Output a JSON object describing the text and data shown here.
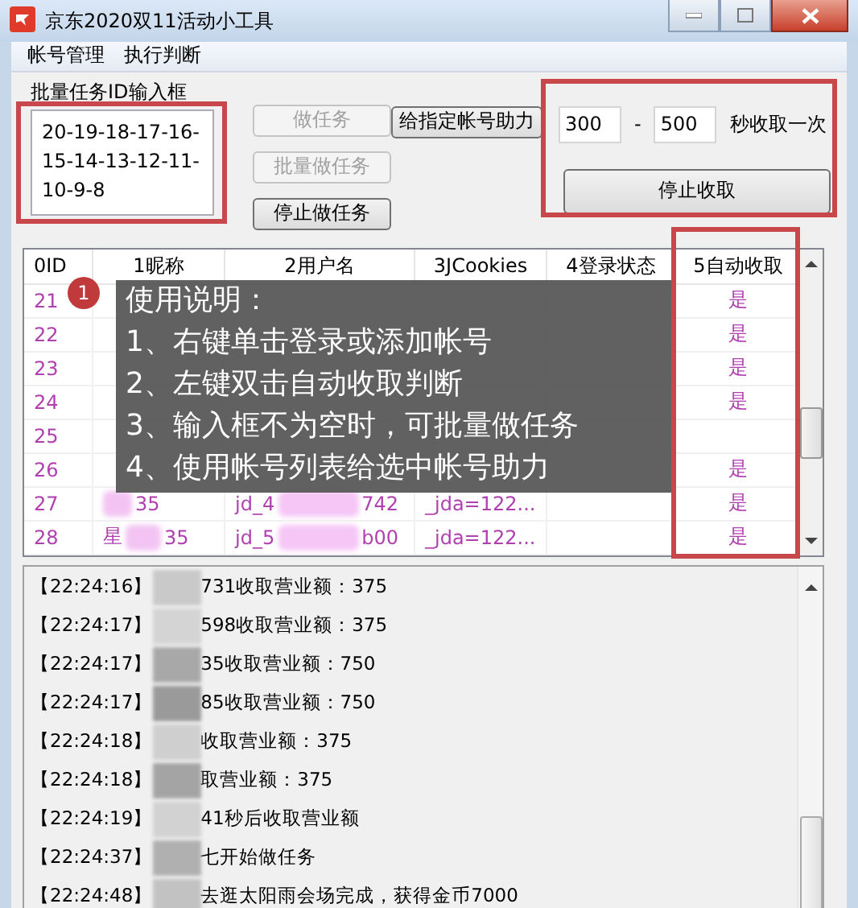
{
  "window": {
    "title": "京东2020双11活动小工具"
  },
  "menu": [
    {
      "label": "帐号管理"
    },
    {
      "label": "执行判断"
    }
  ],
  "task_panel": {
    "label": "批量任务ID输入框",
    "ids_value": "20-19-18-17-16-15-14-13-12-11-10-9-8",
    "buttons": [
      {
        "label": "做任务",
        "disabled": true
      },
      {
        "label": "批量做任务",
        "disabled": true
      },
      {
        "label": "停止做任务",
        "disabled": false
      }
    ],
    "assist_button": "给指定帐号助力",
    "interval": {
      "min": "300",
      "separator": "-",
      "max": "500",
      "unit": "秒收取一次"
    },
    "stop_button": "停止收取"
  },
  "table": {
    "columns": [
      "0ID",
      "1昵称",
      "2用户名",
      "3JCookies",
      "4登录状态",
      "5自动收取"
    ],
    "rows": [
      {
        "id": "21",
        "auto": "是"
      },
      {
        "id": "22",
        "auto": "是"
      },
      {
        "id": "23",
        "auto": "是"
      },
      {
        "id": "24",
        "auto": "是"
      },
      {
        "id": "25"
      },
      {
        "id": "26",
        "auto": "是"
      },
      {
        "id": "27",
        "nickname_parts": [
          "35"
        ],
        "username_parts": [
          "jd_4",
          "742"
        ],
        "cookies": "_jda=122...",
        "auto": "是"
      },
      {
        "id": "28",
        "nickname_parts": [
          "星",
          "35"
        ],
        "username_parts": [
          "jd_5",
          "b00"
        ],
        "cookies": "_jda=122...",
        "auto": "是"
      }
    ]
  },
  "guide": {
    "badge": "1",
    "title": "使用说明：",
    "lines": [
      "1、右键单击登录或添加帐号",
      "2、左键双击自动收取判断",
      "3、输入框不为空时，可批量做任务",
      "4、使用帐号列表给选中帐号助力"
    ]
  },
  "log": [
    {
      "time": "【22:24:16】",
      "text": "731收取营业额：375"
    },
    {
      "time": "【22:24:17】",
      "text": "598收取营业额：375"
    },
    {
      "time": "【22:24:17】",
      "text": "35收取营业额：750"
    },
    {
      "time": "【22:24:17】",
      "text": "85收取营业额：750"
    },
    {
      "time": "【22:24:18】",
      "text": "收取营业额：375"
    },
    {
      "time": "【22:24:18】",
      "text": "取营业额：375"
    },
    {
      "time": "【22:24:19】",
      "text": "41秒后收取营业额"
    },
    {
      "time": "【22:24:37】",
      "text": "七开始做任务"
    },
    {
      "time": "【22:24:48】",
      "text": "去逛太阳雨会场完成，获得金币7000"
    }
  ]
}
